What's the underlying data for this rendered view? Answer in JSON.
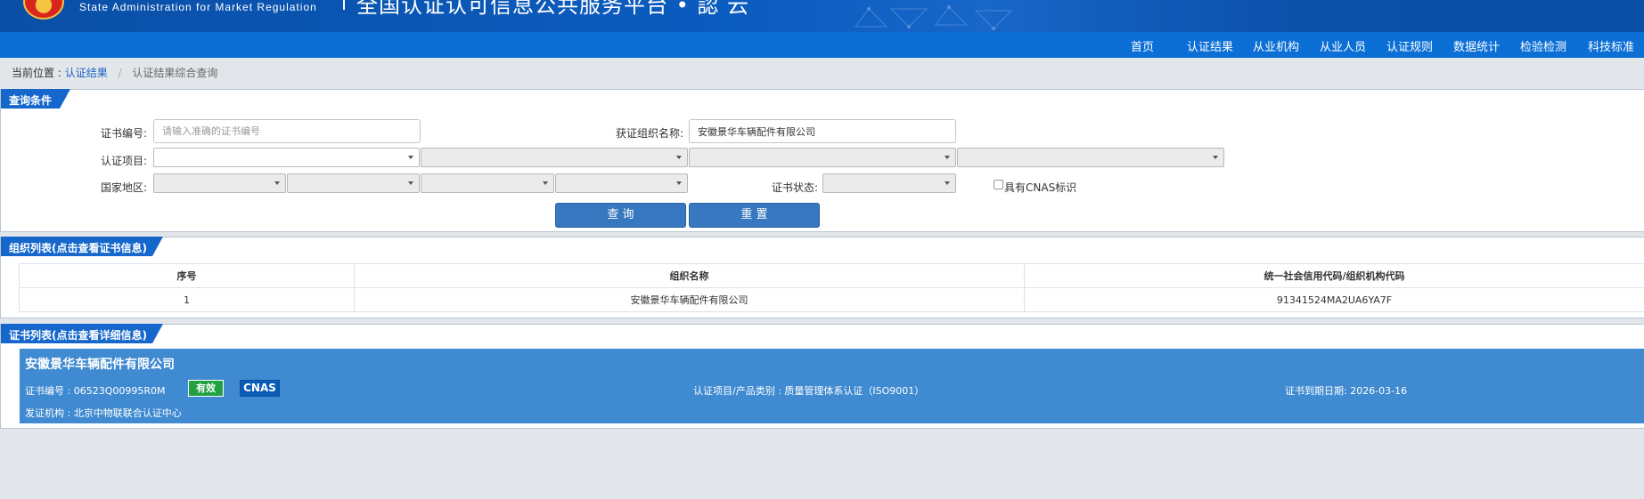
{
  "header": {
    "subtitle_en": "State Administration  for  Market Regulation",
    "site_title": "全国认证认可信息公共服务平台 • 認 云"
  },
  "nav": [
    {
      "label": "首页"
    },
    {
      "label": "认证结果"
    },
    {
      "label": "从业机构"
    },
    {
      "label": "从业人员"
    },
    {
      "label": "认证规则"
    },
    {
      "label": "数据统计"
    },
    {
      "label": "检验检测"
    },
    {
      "label": "科技标准"
    }
  ],
  "breadcrumb": {
    "prefix": "当前位置 :",
    "link": "认证结果",
    "separator": "/",
    "current": "认证结果综合查询"
  },
  "query": {
    "title": "查询条件",
    "cert_no_label": "证书编号:",
    "cert_no_placeholder": "请输入准确的证书编号",
    "org_name_label": "获证组织名称:",
    "org_name_value": "安徽景华车辆配件有限公司",
    "cert_item_label": "认证项目:",
    "region_label": "国家地区:",
    "status_label": "证书状态:",
    "cnas_label": "具有CNAS标识",
    "search_button": "查 询",
    "reset_button": "重 置"
  },
  "org_list": {
    "title": "组织列表(点击查看证书信息)",
    "columns": [
      "序号",
      "组织名称",
      "统一社会信用代码/组织机构代码"
    ],
    "rows": [
      [
        "1",
        "安徽景华车辆配件有限公司",
        "91341524MA2UA6YA7F"
      ]
    ]
  },
  "cert_list": {
    "title": "证书列表(点击查看详细信息)",
    "items": [
      {
        "org_name": "安徽景华车辆配件有限公司",
        "cert_no_text": "证书编号 : 06523Q00995R0M",
        "status_badge": "有效",
        "cnas_badge": "CNAS",
        "category_text": "认证项目/产品类别 : 质量管理体系认证（ISO9001）",
        "expiry_text": "证书到期日期: 2026-03-16",
        "issuer_text": "发证机构 : 北京中物联联合认证中心"
      }
    ]
  },
  "colors": {
    "header_blue": "#0b5cc0",
    "nav_blue": "#0b6fd6",
    "tab_blue": "#1567cc",
    "card_blue": "#3f8ad0",
    "valid_green": "#21a142"
  }
}
